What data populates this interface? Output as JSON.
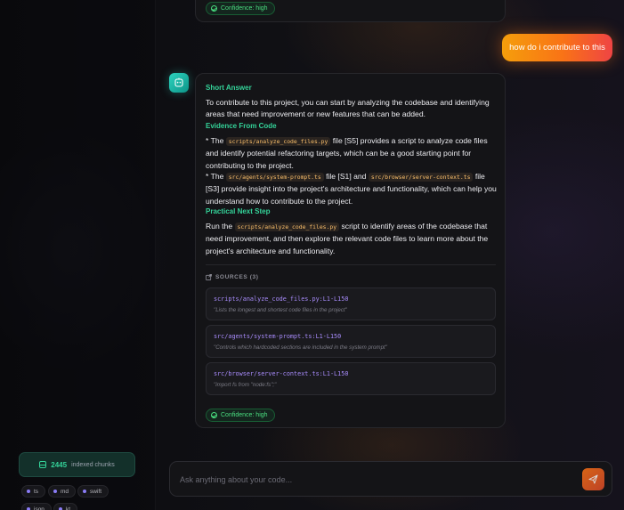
{
  "colors": {
    "accent_orange": "#f97316",
    "accent_green": "#34d399",
    "accent_teal": "#2dd4bf",
    "source_path": "#a78bfa",
    "code_text": "#fbbf6a"
  },
  "previous_message": {
    "confidence": "Confidence: high"
  },
  "user_message": {
    "text": "how do i contribute to this"
  },
  "assistant": {
    "avatar_icon": "bot-icon",
    "short_answer_title": "Short Answer",
    "short_answer_text": "To contribute to this project, you can start by analyzing the codebase and identifying areas that need improvement or new features that can be added.",
    "evidence_title": "Evidence From Code",
    "evidence_1": {
      "prefix": "* The",
      "code": "scripts/analyze_code_files.py",
      "suffix": "file [S5] provides a script to analyze code files and identify potential refactoring targets, which can be a good starting point for contributing to the project."
    },
    "evidence_2": {
      "prefix": "* The",
      "code_a": "src/agents/system-prompt.ts",
      "middle": "file [S1] and",
      "code_b": "src/browser/server-context.ts",
      "suffix": "file [S3] provide insight into the project's architecture and functionality, which can help you understand how to contribute to the project."
    },
    "next_step_title": "Practical Next Step",
    "next_step": {
      "prefix": "Run the",
      "code": "scripts/analyze_code_files.py",
      "suffix": "script to identify areas of the codebase that need improvement, and then explore the relevant code files to learn more about the project's architecture and functionality."
    },
    "sources_header": "SOURCES (3)",
    "sources": [
      {
        "path": "scripts/analyze_code_files.py:L1-L150",
        "desc": "\"Lists the longest and shortest code files in the project\""
      },
      {
        "path": "src/agents/system-prompt.ts:L1-L150",
        "desc": "\"Controls which hardcoded sections are included in the system prompt\""
      },
      {
        "path": "src/browser/server-context.ts:L1-L150",
        "desc": "\"import fs from \"node:fs\";\""
      }
    ],
    "confidence": "Confidence: high"
  },
  "sidebar": {
    "chunks_count": "2445",
    "chunks_label": "indexed chunks",
    "languages": [
      "ts",
      "md",
      "swift",
      "json",
      "kt"
    ]
  },
  "composer": {
    "placeholder": "Ask anything about your code...",
    "send_icon": "send-icon"
  }
}
